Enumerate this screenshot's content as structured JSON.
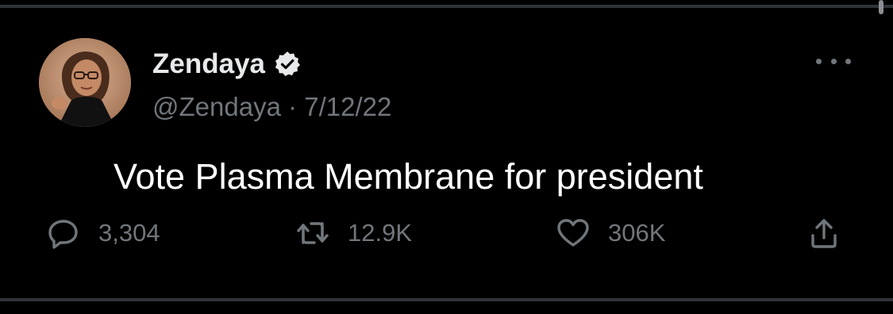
{
  "tweet": {
    "author": {
      "display_name": "Zendaya",
      "handle": "@Zendaya",
      "verified": true,
      "avatar": "profile-photo"
    },
    "separator": " · ",
    "date": "7/12/22",
    "text": "Vote Plasma Membrane for president",
    "stats": {
      "replies": "3,304",
      "retweets": "12.9K",
      "likes": "306K"
    },
    "icons": {
      "reply": "speech-bubble-icon",
      "retweet": "retweet-arrows-icon",
      "like": "heart-icon",
      "share": "share-upload-icon",
      "more": "ellipsis-icon",
      "verified": "verified-badge-icon"
    }
  },
  "colors": {
    "background": "#000000",
    "primary_text": "#e7e9ea",
    "secondary_text": "#71767b",
    "divider": "#2f3336"
  }
}
